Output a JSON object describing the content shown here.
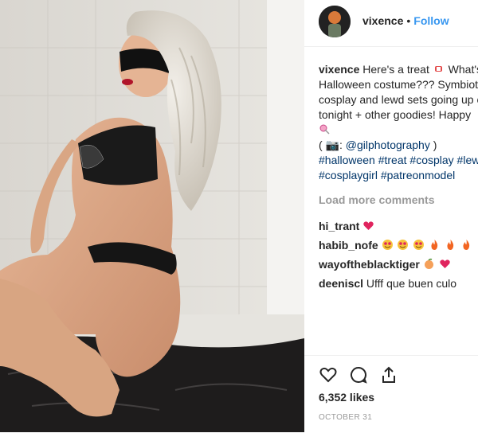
{
  "post": {
    "username": "vixence",
    "separator": "•",
    "follow_label": "Follow",
    "caption_lines": [
      "Here's a treat",
      "What's",
      "Halloween costume??? Symbiote",
      "cosplay and lewd sets going up c",
      "tonight + other goodies! Happy",
      "( 📷: ",
      "@gilphotography",
      " )"
    ],
    "hashtags_line1": "#halloween #treat #cosplay #lew",
    "hashtags_line2": "#cosplaygirl #patreonmodel",
    "load_more": "Load more comments",
    "comments": [
      {
        "user": "hi_trant",
        "text": ""
      },
      {
        "user": "habib_nofe",
        "text": ""
      },
      {
        "user": "wayoftheblacktiger",
        "text": ""
      },
      {
        "user": "deeniscl",
        "text": "Ufff que buen culo"
      }
    ],
    "likes": "6,352 likes",
    "date": "OCTOBER 31"
  },
  "icons": [
    "heart-icon",
    "comment-icon",
    "share-icon"
  ]
}
